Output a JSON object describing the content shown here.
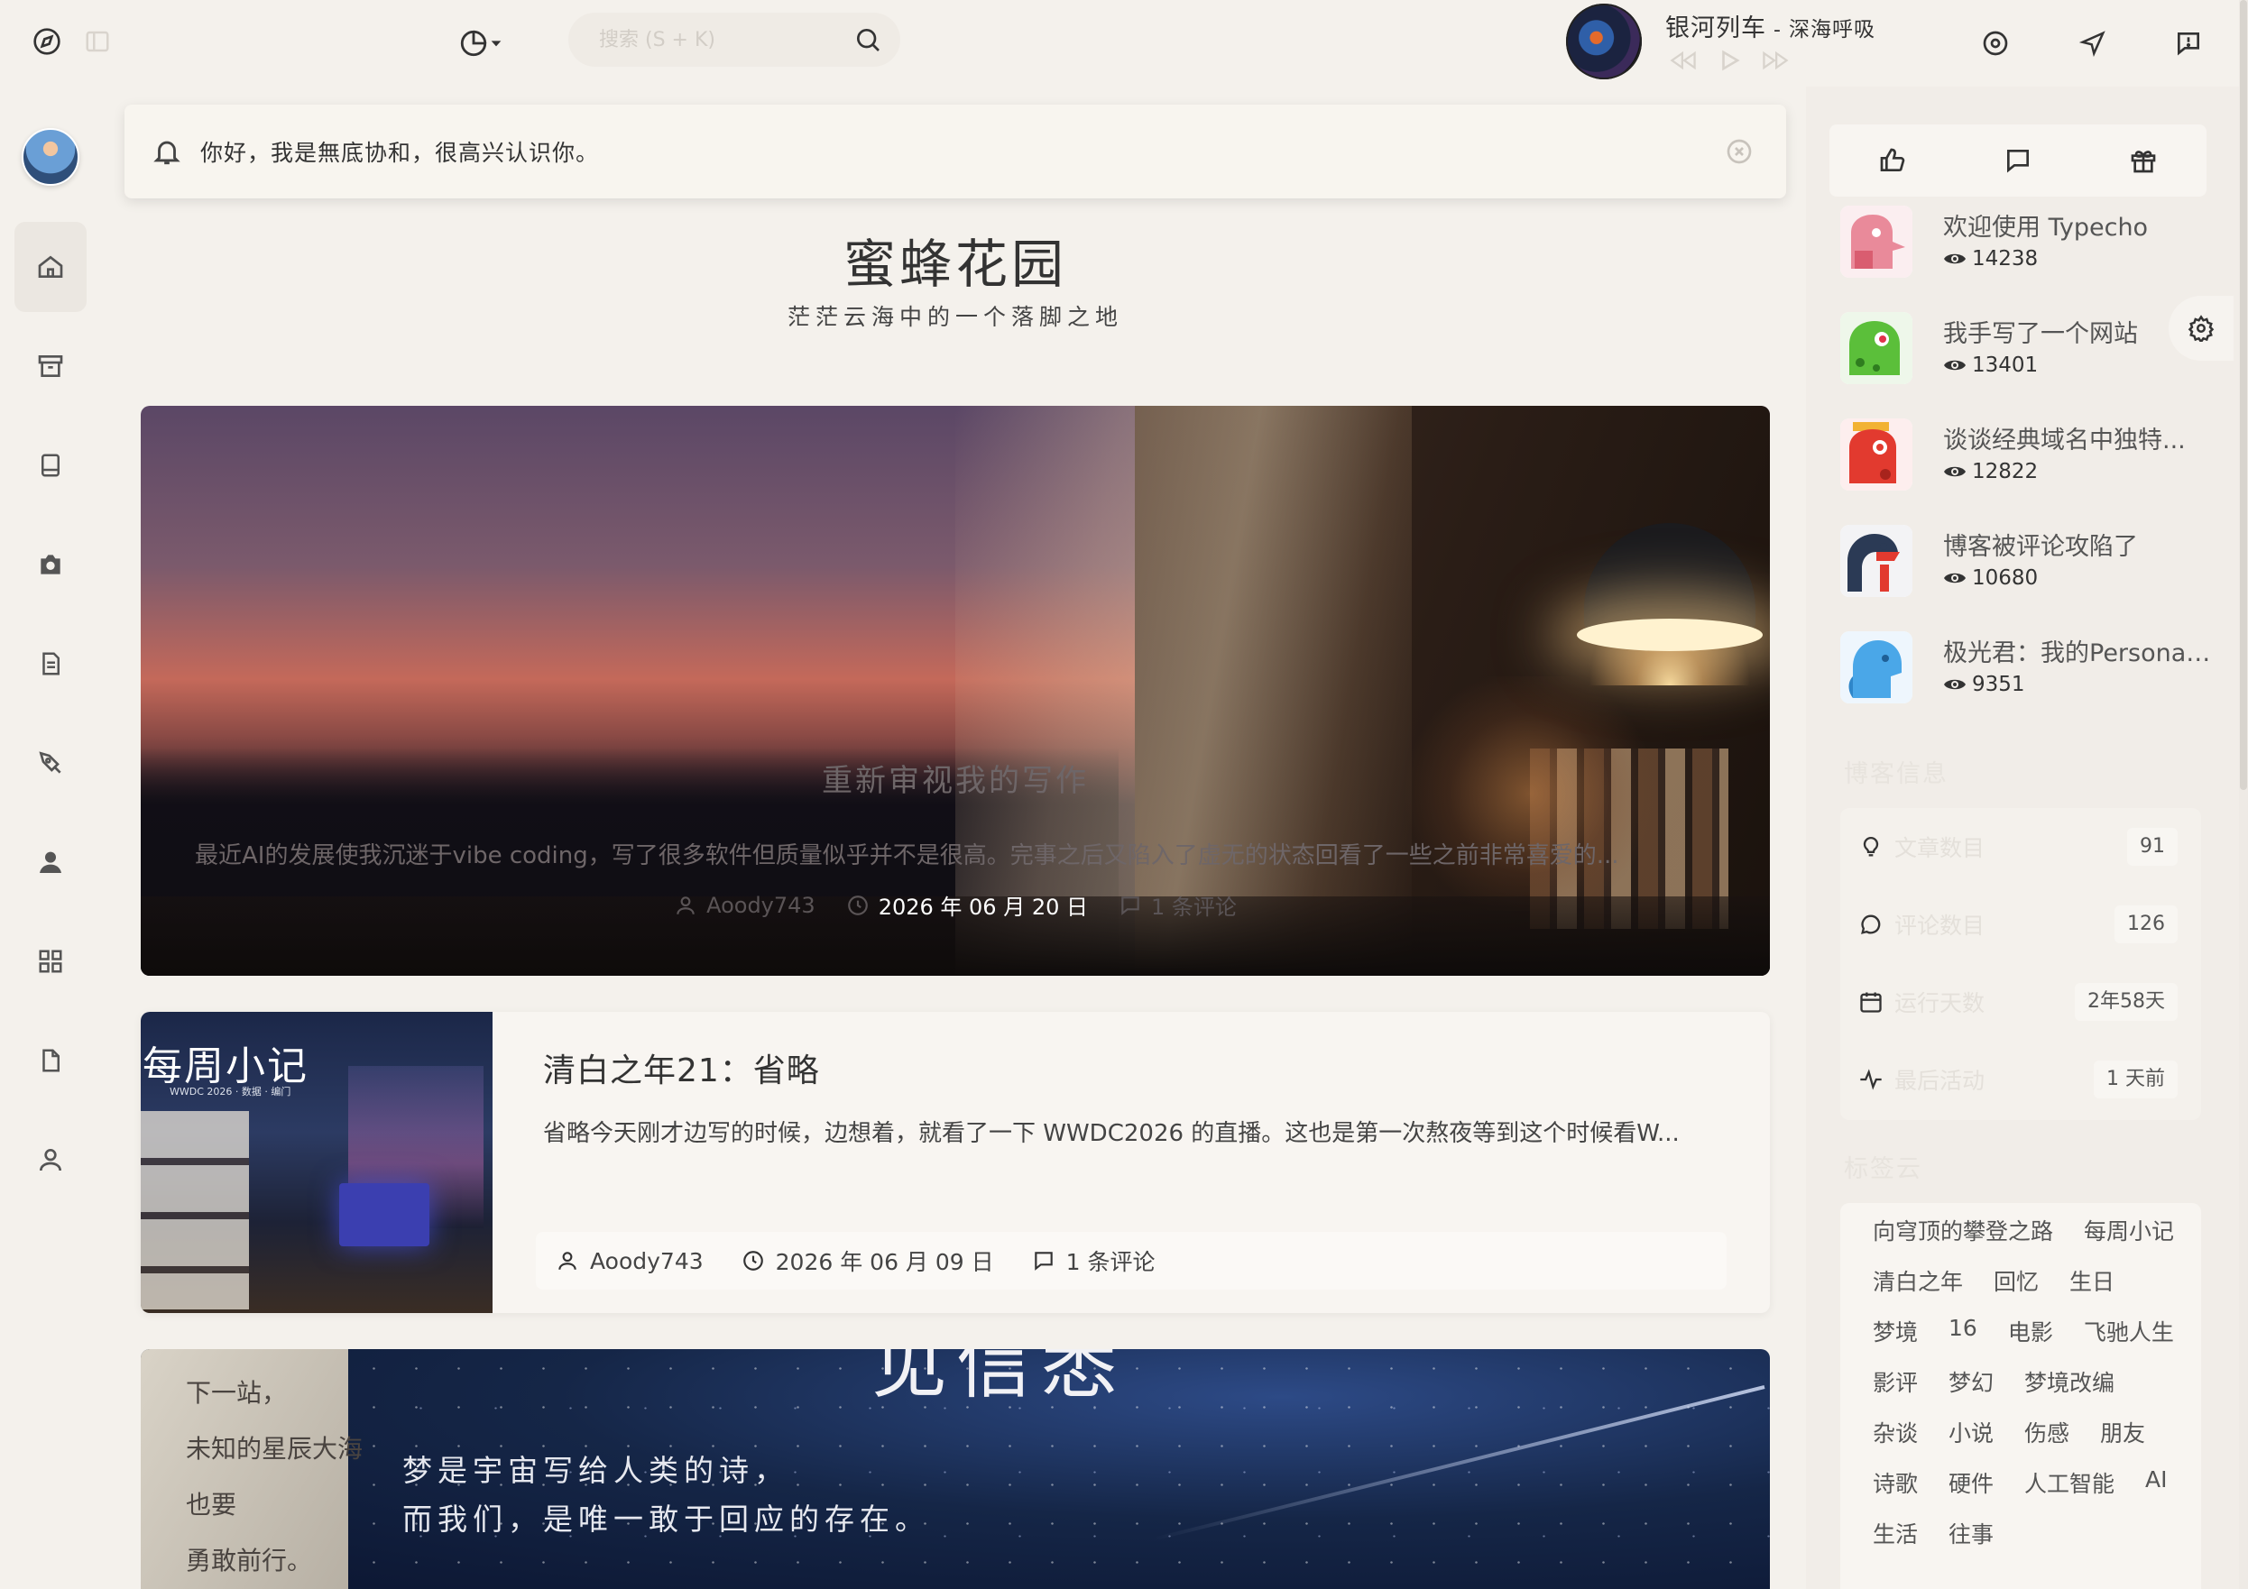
{
  "topbar": {
    "search_placeholder": "搜索 (S + K)",
    "song": {
      "title": "银河列车",
      "separator": " - ",
      "artist": "深海呼吸"
    }
  },
  "notice": {
    "message": "你好，我是無底协和，很高兴认识你。"
  },
  "site": {
    "title": "蜜蜂花园",
    "subtitle": "茫茫云海中的一个落脚之地"
  },
  "hero_post": {
    "title": "重新审视我的写作",
    "excerpt": "最近AI的发展使我沉迷于vibe coding，写了很多软件但质量似乎并不是很高。完事之后又陷入了虚无的状态回看了一些之前非常喜爱的...",
    "author": "Aoody743",
    "date": "2026 年 06 月 20 日",
    "comments": "1 条评论"
  },
  "post_card": {
    "thumb_title": "每周小记",
    "thumb_sub": "WWDC 2026 · 数据 · 编门",
    "title": "清白之年21：省略",
    "excerpt": "省略今天刚才边写的时候，边想着，就看了一下 WWDC2026 的直播。这也是第一次熬夜等到这个时候看W...",
    "author": "Aoody743",
    "date": "2026 年 06 月 09 日",
    "comments": "1 条评论"
  },
  "bottom_hero": {
    "big_title": "见信悉",
    "poem_line1": "梦是宇宙写给人类的诗，",
    "poem_line2": "而我们，是唯一敢于回应的存在。",
    "paper_lines": [
      "下一站，",
      "未知的星辰大海",
      "也要",
      "勇敢前行。"
    ]
  },
  "hot_posts": [
    {
      "title": "欢迎使用 Typecho",
      "views": "14238",
      "color": "#e98a9a"
    },
    {
      "title": "我手写了一个网站",
      "views": "13401",
      "color": "#5bbf3a"
    },
    {
      "title": "谈谈经典域名中独特...",
      "views": "12822",
      "color": "#e23a2f"
    },
    {
      "title": "博客被评论攻陷了",
      "views": "10680",
      "color": "#2b3a55"
    },
    {
      "title": "极光君：我的Persona ...",
      "views": "9351",
      "color": "#4aa7e8"
    }
  ],
  "blog_info": {
    "title": "博客信息",
    "rows": [
      {
        "label": "文章数目",
        "value": "91",
        "icon": "bulb-icon"
      },
      {
        "label": "评论数目",
        "value": "126",
        "icon": "comment-icon"
      },
      {
        "label": "运行天数",
        "value": "2年58天",
        "icon": "calendar-icon"
      },
      {
        "label": "最后活动",
        "value": "1 天前",
        "icon": "activity-icon"
      }
    ]
  },
  "tag_cloud": {
    "title": "标签云",
    "rows": [
      [
        "向穹顶的攀登之路",
        "每周小记"
      ],
      [
        "清白之年",
        "回忆",
        "生日"
      ],
      [
        "梦境",
        "16",
        "电影",
        "飞驰人生"
      ],
      [
        "影评",
        "梦幻",
        "梦境改编"
      ],
      [
        "杂谈",
        "小说",
        "伤感",
        "朋友"
      ],
      [
        "诗歌",
        "硬件",
        "人工智能",
        "AI"
      ],
      [
        "生活",
        "往事"
      ]
    ]
  }
}
